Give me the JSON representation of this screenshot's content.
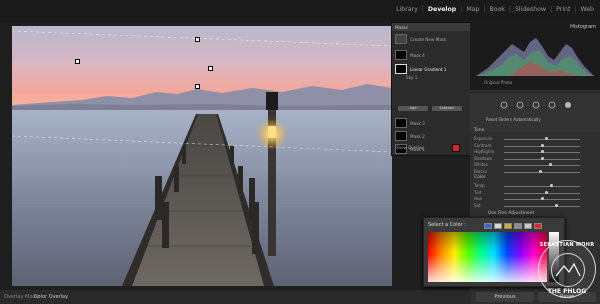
{
  "topbar": {
    "modules": [
      "Library",
      "Develop",
      "Map",
      "Book",
      "Slideshow",
      "Print",
      "Web"
    ],
    "active_module": "Develop"
  },
  "masks_panel": {
    "title": "Masks",
    "create_new": "Create New Mask",
    "items": [
      {
        "label": "Mask 4"
      },
      {
        "label": "Linear Gradient 1"
      },
      {
        "label": "Sky 1"
      }
    ],
    "add_label": "Add",
    "subtract_label": "Subtract",
    "other_masks": [
      "Mask 3",
      "Mask 2",
      "Mask 1"
    ],
    "show_overlay": "Show Overlay",
    "overlay_color": "#d8212b"
  },
  "right_panel": {
    "histogram_title": "Histogram",
    "original_photo": "Original Photo",
    "reset_sliders": "Reset Sliders Automatically",
    "sections": {
      "tone": "Tone",
      "color": "Color",
      "use_fine": "Use Fine Adjustment"
    },
    "tone_sliders": [
      {
        "label": "Exposure",
        "pos": 0.55
      },
      {
        "label": "Contrast",
        "pos": 0.5
      },
      {
        "label": "Highlights",
        "pos": 0.5
      },
      {
        "label": "Shadows",
        "pos": 0.5
      },
      {
        "label": "Whites",
        "pos": 0.6
      },
      {
        "label": "Blacks",
        "pos": 0.48
      }
    ],
    "color_sliders": [
      {
        "label": "Temp",
        "pos": 0.62
      },
      {
        "label": "Tint",
        "pos": 0.55
      },
      {
        "label": "Hue",
        "pos": 0.5
      },
      {
        "label": "Sat",
        "pos": 0.68
      }
    ],
    "bottom_buttons": {
      "previous": "Previous",
      "reset": "Reset"
    }
  },
  "bottombar": {
    "overlay_mode_label": "Overlay Mode",
    "color_overlay": "Color Overlay"
  },
  "color_picker": {
    "title": "Select a Color :",
    "swatches": [
      "#3b66d6",
      "#d6d6d6",
      "#c7b13e",
      "#8e8e8e",
      "#c9c9c9",
      "#d92c2c"
    ]
  },
  "watermark": {
    "name": "SEBASTIAN MOHR",
    "brand": "THE PHLOG"
  },
  "colors": {
    "accent": "#d8212b",
    "panel_bg": "#2f2f2f",
    "app_bg": "#1f1f1f"
  }
}
